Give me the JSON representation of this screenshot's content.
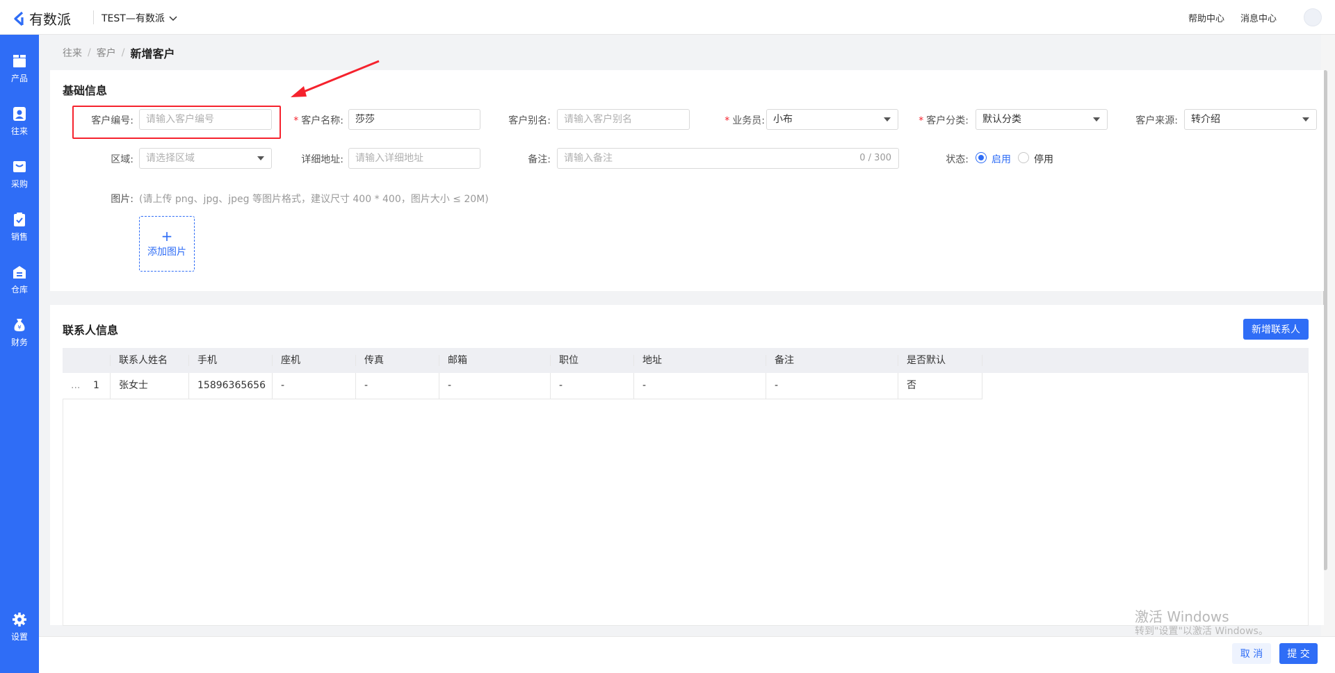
{
  "header": {
    "logo_text": "有数派",
    "company": "TEST—有数派",
    "help": "帮助中心",
    "messages": "消息中心"
  },
  "sidebar": {
    "items": [
      {
        "label": "产品",
        "icon": "box-icon"
      },
      {
        "label": "往来",
        "icon": "contact-icon"
      },
      {
        "label": "采购",
        "icon": "cart-icon"
      },
      {
        "label": "销售",
        "icon": "clipboard-icon"
      },
      {
        "label": "仓库",
        "icon": "warehouse-icon"
      },
      {
        "label": "财务",
        "icon": "money-bag-icon"
      },
      {
        "label": "设置",
        "icon": "gear-icon"
      }
    ],
    "active_index": 1
  },
  "breadcrumb": {
    "items": [
      "往来",
      "客户"
    ],
    "current": "新增客户",
    "separator": "/"
  },
  "basic": {
    "title": "基础信息",
    "customer_code": {
      "label": "客户编号:",
      "placeholder": "请输入客户编号"
    },
    "customer_name": {
      "label": "客户名称:",
      "value": "莎莎"
    },
    "alias": {
      "label": "客户别名:",
      "placeholder": "请输入客户别名"
    },
    "salesperson": {
      "label": "业务员:",
      "value": "小布"
    },
    "category": {
      "label": "客户分类:",
      "value": "默认分类"
    },
    "source": {
      "label": "客户来源:",
      "value": "转介绍"
    },
    "region": {
      "label": "区域:",
      "placeholder": "请选择区域"
    },
    "address": {
      "label": "详细地址:",
      "placeholder": "请输入详细地址"
    },
    "remark": {
      "label": "备注:",
      "placeholder": "请输入备注",
      "counter": "0 / 300"
    },
    "status": {
      "label": "状态:",
      "options": [
        "启用",
        "停用"
      ],
      "selected": "启用"
    },
    "image": {
      "label": "图片:",
      "hint": "(请上传 png、jpg、jpeg 等图片格式，建议尺寸 400 * 400，图片大小 ≤ 20M)",
      "add_label": "添加图片",
      "plus": "+"
    }
  },
  "contacts": {
    "title": "联系人信息",
    "add_button": "新增联系人",
    "columns": [
      "联系人姓名",
      "手机",
      "座机",
      "传真",
      "邮箱",
      "职位",
      "地址",
      "备注",
      "是否默认"
    ],
    "rows": [
      {
        "drag": "...",
        "index": "1",
        "name": "张女士",
        "mobile": "15896365656",
        "phone": "-",
        "fax": "-",
        "email": "-",
        "position": "-",
        "address": "-",
        "remark": "-",
        "default": "否"
      }
    ]
  },
  "footer": {
    "cancel": "取 消",
    "submit": "提 交"
  },
  "watermark": {
    "line1": "激活 Windows",
    "line2": "转到\"设置\"以激活 Windows。"
  },
  "colors": {
    "primary": "#2f6df6",
    "required": "#f5222d",
    "annotation": "#f5222d"
  }
}
